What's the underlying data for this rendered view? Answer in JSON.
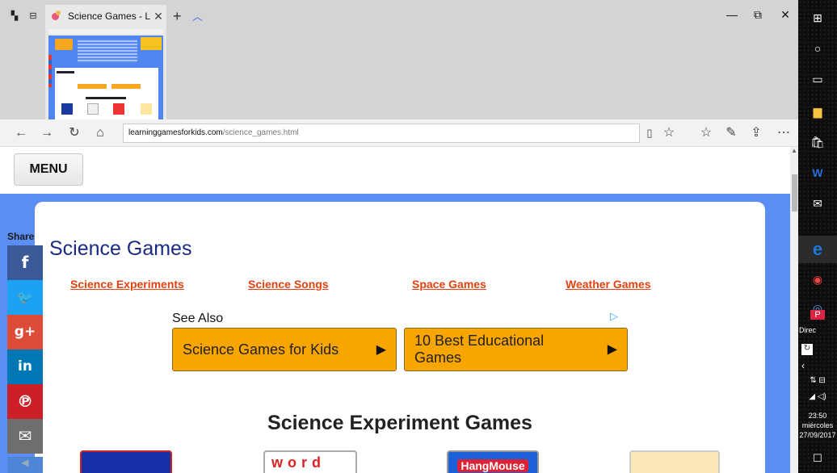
{
  "browser": {
    "tab_title": "Science Games - Learnin",
    "url_domain": "learninggamesforkids.com",
    "url_path": "/science_games.html"
  },
  "page": {
    "menu_label": "MENU",
    "title": "Science Games",
    "category_links": [
      "Science Experiments",
      "Science Songs",
      "Space Games",
      "Weather Games"
    ],
    "see_also_label": "See Also",
    "ad_buttons": [
      "Science Games for Kids",
      "10 Best Educational Games"
    ],
    "subtitle": "Science Experiment Games",
    "game_thumbs": [
      "word",
      "HangMouse"
    ]
  },
  "share": {
    "label": "Share",
    "buttons": [
      {
        "network": "facebook",
        "glyph": "f",
        "color": "#3b5998"
      },
      {
        "network": "twitter",
        "glyph": "🐦",
        "color": "#1da1f2"
      },
      {
        "network": "google-plus",
        "glyph": "g+",
        "color": "#dd4b39"
      },
      {
        "network": "linkedin",
        "glyph": "in",
        "color": "#0077b5"
      },
      {
        "network": "pinterest",
        "glyph": "℗",
        "color": "#cb2027"
      },
      {
        "network": "email",
        "glyph": "✉",
        "color": "#6e6e6e"
      }
    ]
  },
  "taskbar": {
    "label_direc": "Direc",
    "time": "23:50",
    "day": "miércoles",
    "date": "27/09/2017"
  }
}
